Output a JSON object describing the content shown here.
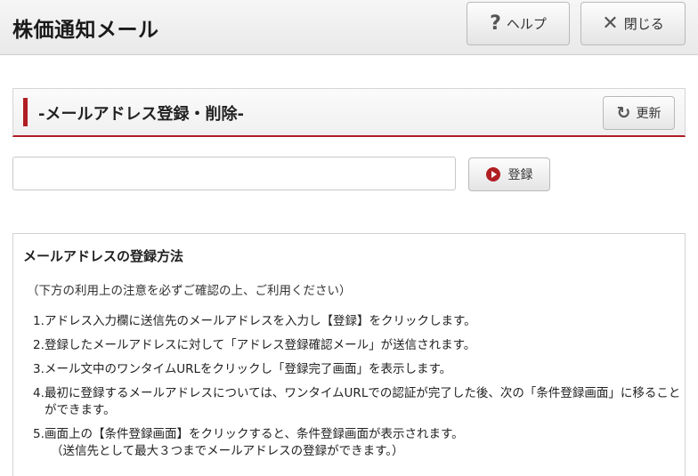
{
  "header": {
    "title": "株価通知メール",
    "help_label": "ヘルプ",
    "close_label": "閉じる"
  },
  "section": {
    "title": "-メールアドレス登録・削除-",
    "refresh_label": "更新"
  },
  "form": {
    "email_value": "",
    "register_label": "登録"
  },
  "info": {
    "title": "メールアドレスの登録方法",
    "note": "（下方の利用上の注意を必ずご確認の上、ご利用ください）",
    "steps": [
      {
        "num": "1.",
        "text": "アドレス入力欄に送信先のメールアドレスを入力し【登録】をクリックします。"
      },
      {
        "num": "2.",
        "text": "登録したメールアドレスに対して「アドレス登録確認メール」が送信されます。"
      },
      {
        "num": "3.",
        "text": "メール文中のワンタイムURLをクリックし「登録完了画面」を表示します。"
      },
      {
        "num": "4.",
        "text": "最初に登録するメールアドレスについては、ワンタイムURLでの認証が完了した後、次の「条件登録画面」に移ることができます。"
      },
      {
        "num": "5.",
        "text": "画面上の【条件登録画面】をクリックすると、条件登録画面が表示されます。",
        "sub": "（送信先として最大３つまでメールアドレスの登録ができます。）"
      }
    ]
  },
  "colors": {
    "accent": "#b01e23"
  },
  "icons": {
    "help": "question-mark-icon",
    "close": "x-mark-icon",
    "refresh": "refresh-icon",
    "register": "play-circle-icon"
  }
}
